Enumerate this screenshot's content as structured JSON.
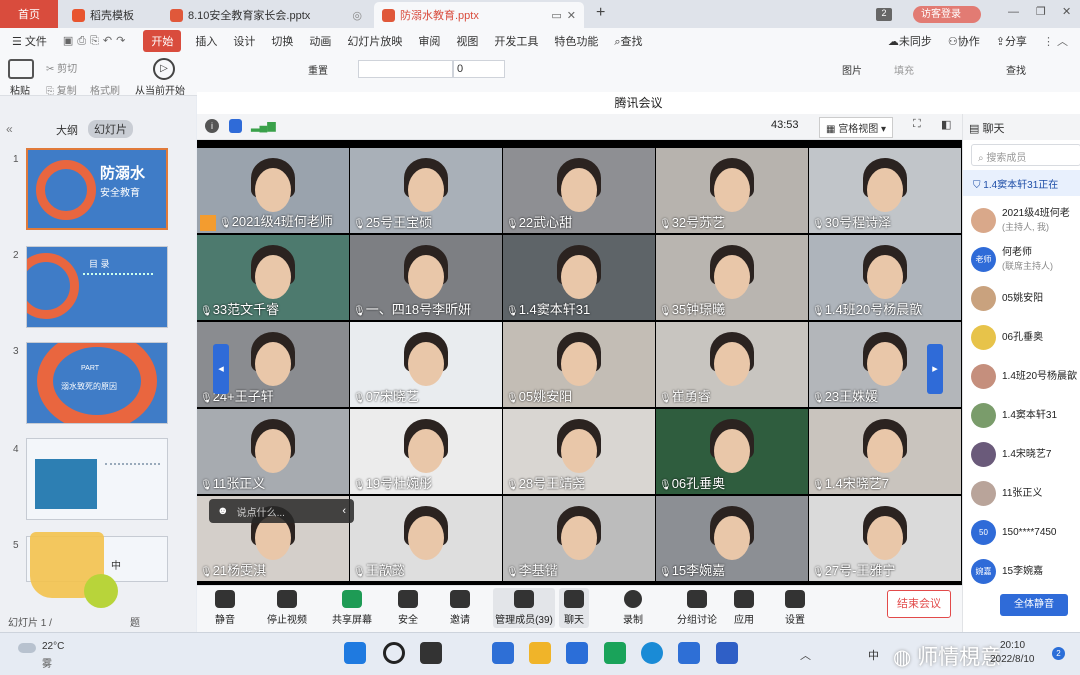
{
  "tabs": {
    "home": "首页",
    "t1": "稻壳模板",
    "t2": "8.10安全教育家长会.pptx",
    "t3": "防溺水教育.pptx",
    "new_tab": "+",
    "count": "2",
    "login": "访客登录"
  },
  "menu": {
    "file": "文件",
    "start": "开始",
    "items": [
      "插入",
      "设计",
      "切换",
      "动画",
      "幻灯片放映",
      "审阅",
      "视图",
      "开发工具",
      "特色功能"
    ],
    "search": "查找",
    "sync": "未同步",
    "collab": "协作",
    "share": "分享"
  },
  "ribbon": {
    "paste": "粘贴",
    "cut": "剪切",
    "copy": "复制",
    "format": "格式刷",
    "from_current": "从当前开始",
    "reset": "重置",
    "font_size": "0",
    "image": "图片",
    "fill": "填充",
    "find": "查找"
  },
  "slides": {
    "outline_tab": "大纲",
    "slides_tab": "幻灯片",
    "numbers": [
      "1",
      "2",
      "3",
      "4",
      "5"
    ],
    "s1_title": "防溺水",
    "s1_sub": "安全教育",
    "s2_title": "目 录",
    "s3_part": "PART",
    "s3_title": "溺水致死的原因",
    "s5_label": "中",
    "status": "幻灯片 1 /",
    "status_right": "题"
  },
  "meeting": {
    "title": "腾讯会议",
    "timer": "43:53",
    "view": "宫格视图",
    "chat_tab": "聊天",
    "search_placeholder": "搜索成员",
    "notice": "1.4窦本轩31正在",
    "chat_input": "说点什么...",
    "participants": [
      "2021级4班何老师",
      "25号王宝硕",
      "22武心甜",
      "32号苏艺",
      "30号程诗泽",
      "33范文千睿",
      "一、四18号李昕妍",
      "1.4窦本轩31",
      "35钟璟曦",
      "1.4班20号杨晨歆",
      "24+王子轩",
      "07宋晓艺",
      "05姚安阳",
      "崔勇睿",
      "23王姝媛",
      "11张正义",
      "19号杜婉彤",
      "28号王靖尧",
      "06孔垂奥",
      "1.4宋晓艺7",
      "21杨雯淇",
      "王歆懿",
      "李基锴",
      "15李婉嘉",
      "27号-王雅宁"
    ],
    "members": [
      {
        "name": "2021级4班何老",
        "sub": "(主持人, 我)",
        "avatar": ""
      },
      {
        "name": "何老师",
        "sub": "(联席主持人)",
        "avatar": "老师"
      },
      {
        "name": "05姚安阳",
        "sub": "",
        "avatar": ""
      },
      {
        "name": "06孔垂奥",
        "sub": "",
        "avatar": ""
      },
      {
        "name": "1.4班20号杨晨歆",
        "sub": "",
        "avatar": ""
      },
      {
        "name": "1.4窦本轩31",
        "sub": "",
        "avatar": ""
      },
      {
        "name": "1.4宋晓艺7",
        "sub": "",
        "avatar": ""
      },
      {
        "name": "11张正义",
        "sub": "",
        "avatar": ""
      },
      {
        "name": "150****7450",
        "sub": "",
        "avatar": "50"
      },
      {
        "name": "15李婉嘉",
        "sub": "",
        "avatar": "婉嘉"
      }
    ],
    "toolbar": [
      "静音",
      "停止视频",
      "共享屏幕",
      "安全",
      "邀请",
      "管理成员(39)",
      "聊天",
      "录制",
      "分组讨论",
      "应用",
      "设置"
    ],
    "end_button": "结束会议",
    "mute_all": "全体静音"
  },
  "taskbar": {
    "weather_temp": "22°C",
    "weather_desc": "雾",
    "time": "20:10",
    "date": "2022/8/10",
    "watermark": "师情梘意",
    "badge": "2",
    "ime": "中"
  }
}
